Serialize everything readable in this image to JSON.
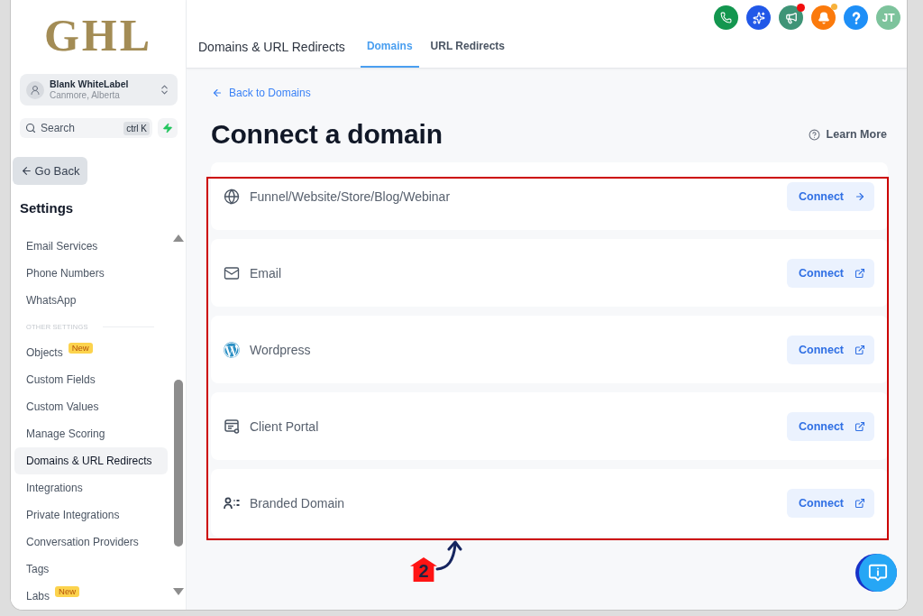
{
  "sidebar": {
    "logo": "GHL",
    "account": {
      "name": "Blank WhiteLabel",
      "location": "Canmore, Alberta"
    },
    "search": {
      "placeholder": "Search",
      "shortcut": "ctrl K"
    },
    "back_button": "Go Back",
    "title": "Settings",
    "groups": [
      {
        "items": [
          {
            "label": "Email Services",
            "selected": false
          },
          {
            "label": "Phone Numbers",
            "selected": false
          },
          {
            "label": "WhatsApp",
            "selected": false
          }
        ]
      },
      {
        "heading": "OTHER SETTINGS",
        "items": [
          {
            "label": "Objects",
            "badge": "New",
            "selected": false
          },
          {
            "label": "Custom Fields",
            "selected": false
          },
          {
            "label": "Custom Values",
            "selected": false
          },
          {
            "label": "Manage Scoring",
            "selected": false
          },
          {
            "label": "Domains & URL Redirects",
            "selected": true
          },
          {
            "label": "Integrations",
            "selected": false
          },
          {
            "label": "Private Integrations",
            "selected": false
          },
          {
            "label": "Conversation Providers",
            "selected": false
          },
          {
            "label": "Tags",
            "selected": false
          },
          {
            "label": "Labs",
            "badge": "New",
            "selected": false
          }
        ]
      }
    ]
  },
  "header": {
    "title": "Domains & URL Redirects",
    "tabs": [
      {
        "label": "Domains",
        "selected": true
      },
      {
        "label": "URL Redirects",
        "selected": false
      }
    ],
    "buttons": [
      {
        "kind": "phone",
        "dot": false
      },
      {
        "kind": "sparkle",
        "dot": false
      },
      {
        "kind": "megaphone",
        "dot": true
      },
      {
        "kind": "bell",
        "dot": true
      },
      {
        "kind": "help",
        "dot": false
      }
    ],
    "avatar": "JT"
  },
  "page": {
    "back_link": "Back to Domains",
    "title": "Connect a domain",
    "learn_more": "Learn More",
    "options": [
      {
        "kind": "globe",
        "label": "Funnel/Website/Store/Blog/Webinar",
        "button": "Connect",
        "opens_new_tab": false
      },
      {
        "kind": "email",
        "label": "Email",
        "button": "Connect",
        "opens_new_tab": true
      },
      {
        "kind": "wordpress",
        "label": "Wordpress",
        "button": "Connect",
        "opens_new_tab": true
      },
      {
        "kind": "portal",
        "label": "Client Portal",
        "button": "Connect",
        "opens_new_tab": true
      },
      {
        "kind": "branded",
        "label": "Branded Domain",
        "button": "Connect",
        "opens_new_tab": true
      }
    ]
  },
  "annotation": {
    "step": "2"
  }
}
